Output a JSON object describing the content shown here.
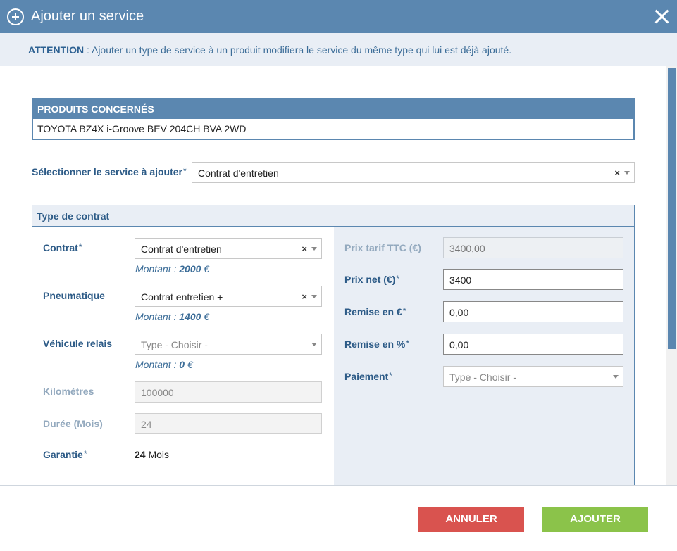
{
  "dialog": {
    "title": "Ajouter un service"
  },
  "attention": {
    "prefix": "ATTENTION",
    "message": " : Ajouter un type de service à un produit modifiera le service du même type qui lui est déjà ajouté."
  },
  "produits": {
    "header": "PRODUITS CONCERNÉS",
    "items": [
      "TOYOTA BZ4X i-Groove BEV 204CH BVA 2WD"
    ]
  },
  "service_select": {
    "label": "Sélectionner le service à ajouter",
    "value": "Contrat d'entretien"
  },
  "contrat_panel": {
    "title": "Type de contrat",
    "contrat": {
      "label": "Contrat",
      "value": "Contrat d'entretien",
      "montant_prefix": "Montant : ",
      "montant_value": "2000",
      "montant_unit": " €"
    },
    "pneumatique": {
      "label": "Pneumatique",
      "value": "Contrat entretien +",
      "montant_prefix": "Montant : ",
      "montant_value": "1400",
      "montant_unit": " €"
    },
    "vehicule_relais": {
      "label": "Véhicule relais",
      "placeholder": "Type - Choisir -",
      "montant_prefix": "Montant : ",
      "montant_value": "0",
      "montant_unit": " €"
    },
    "kilometres": {
      "label": "Kilomètres",
      "value": "100000"
    },
    "duree": {
      "label": "Durée (Mois)",
      "value": "24"
    },
    "garantie": {
      "label": "Garantie",
      "value": "24",
      "unit": "Mois"
    },
    "prix_tarif": {
      "label": "Prix tarif TTC (€)",
      "value": "3400,00"
    },
    "prix_net": {
      "label": "Prix net (€)",
      "value": "3400"
    },
    "remise_euro": {
      "label": "Remise en €",
      "value": "0,00"
    },
    "remise_pct": {
      "label": "Remise en %",
      "value": "0,00"
    },
    "paiement": {
      "label": "Paiement",
      "placeholder": "Type - Choisir -"
    }
  },
  "common": {
    "required_mark": "*",
    "clear_glyph": "×"
  },
  "footer": {
    "cancel_label": "ANNULER",
    "add_label": "AJOUTER"
  },
  "colors": {
    "header": "#5b87b0",
    "cancel": "#d9534f",
    "add": "#8bc34a"
  }
}
